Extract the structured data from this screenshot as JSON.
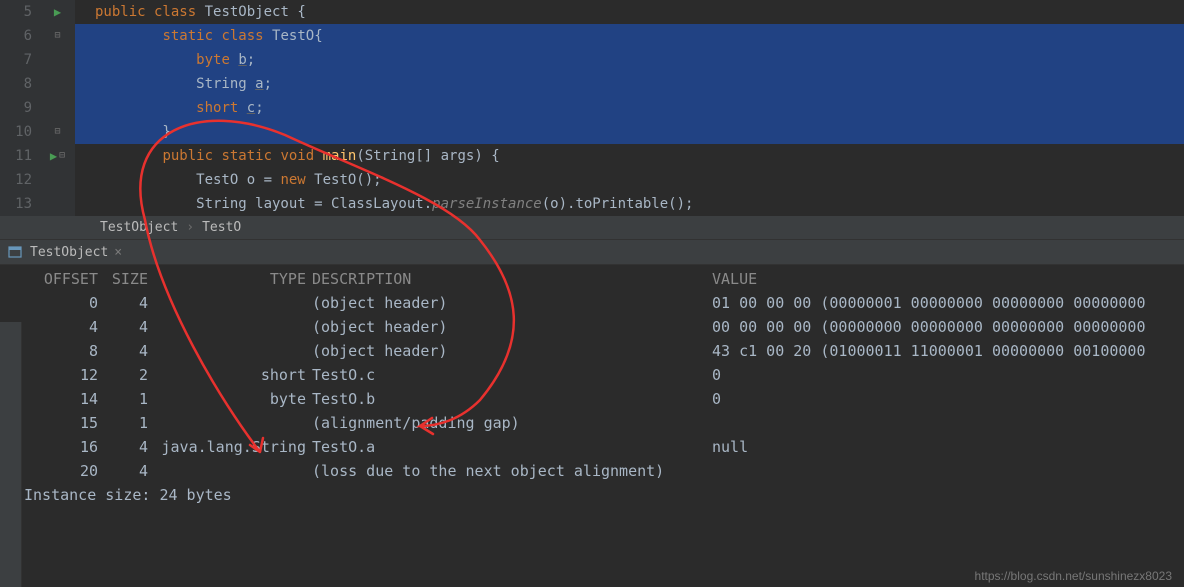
{
  "code": {
    "lines": [
      {
        "n": "5",
        "run": true,
        "fold": "",
        "sel": false,
        "html": "<span class='kw'>public class</span> <span class='cls'>TestObject</span> {"
      },
      {
        "n": "6",
        "run": false,
        "fold": "⊟",
        "sel": true,
        "html": "        <span class='kw'>static</span> <span class='kw'>class</span> <span class='cls'>TestO</span>{"
      },
      {
        "n": "7",
        "run": false,
        "fold": "",
        "sel": true,
        "html": "            <span class='kw'>byte</span> <span class='var ul'>b</span>;"
      },
      {
        "n": "8",
        "run": false,
        "fold": "",
        "sel": true,
        "html": "            String <span class='var ul'>a</span>;"
      },
      {
        "n": "9",
        "run": false,
        "fold": "",
        "sel": true,
        "html": "            <span class='kw'>short</span> <span class='var ul'>c</span>;"
      },
      {
        "n": "10",
        "run": false,
        "fold": "⊟",
        "sel": true,
        "html": "        }"
      },
      {
        "n": "11",
        "run": true,
        "fold": "⊟",
        "sel": false,
        "html": "        <span class='kw'>public static</span> <span class='kw'>void</span> <span class='mth'>main</span>(String[] args) {"
      },
      {
        "n": "12",
        "run": false,
        "fold": "",
        "sel": false,
        "html": "            TestO o = <span class='kw'>new</span> TestO();"
      },
      {
        "n": "13",
        "run": false,
        "fold": "",
        "sel": false,
        "html": "            String layout = ClassLayout.<span class='it'>parseInstance</span>(o).toPrintable();"
      }
    ]
  },
  "breadcrumb": {
    "a": "TestObject",
    "b": "TestO"
  },
  "tab": {
    "label": "TestObject"
  },
  "console": {
    "header": {
      "offset": "OFFSET",
      "size": "SIZE",
      "type": "TYPE",
      "desc": "DESCRIPTION",
      "value": "VALUE"
    },
    "rows": [
      {
        "offset": "0",
        "size": "4",
        "type": "",
        "desc": "(object header)",
        "value": "01 00 00 00 (00000001 00000000 00000000 00000000"
      },
      {
        "offset": "4",
        "size": "4",
        "type": "",
        "desc": "(object header)",
        "value": "00 00 00 00 (00000000 00000000 00000000 00000000"
      },
      {
        "offset": "8",
        "size": "4",
        "type": "",
        "desc": "(object header)",
        "value": "43 c1 00 20 (01000011 11000001 00000000 00100000"
      },
      {
        "offset": "12",
        "size": "2",
        "type": "short",
        "desc": "TestO.c",
        "value": "0"
      },
      {
        "offset": "14",
        "size": "1",
        "type": "byte",
        "desc": "TestO.b",
        "value": "0"
      },
      {
        "offset": "15",
        "size": "1",
        "type": "",
        "desc": "(alignment/padding gap)",
        "value": ""
      },
      {
        "offset": "16",
        "size": "4",
        "type": "java.lang.String",
        "desc": "TestO.a",
        "value": "null"
      },
      {
        "offset": "20",
        "size": "4",
        "type": "",
        "desc": "(loss due to the next object alignment)",
        "value": ""
      }
    ],
    "instSize": "Instance size: 24 bytes"
  },
  "watermark": "https://blog.csdn.net/sunshinezx8023"
}
